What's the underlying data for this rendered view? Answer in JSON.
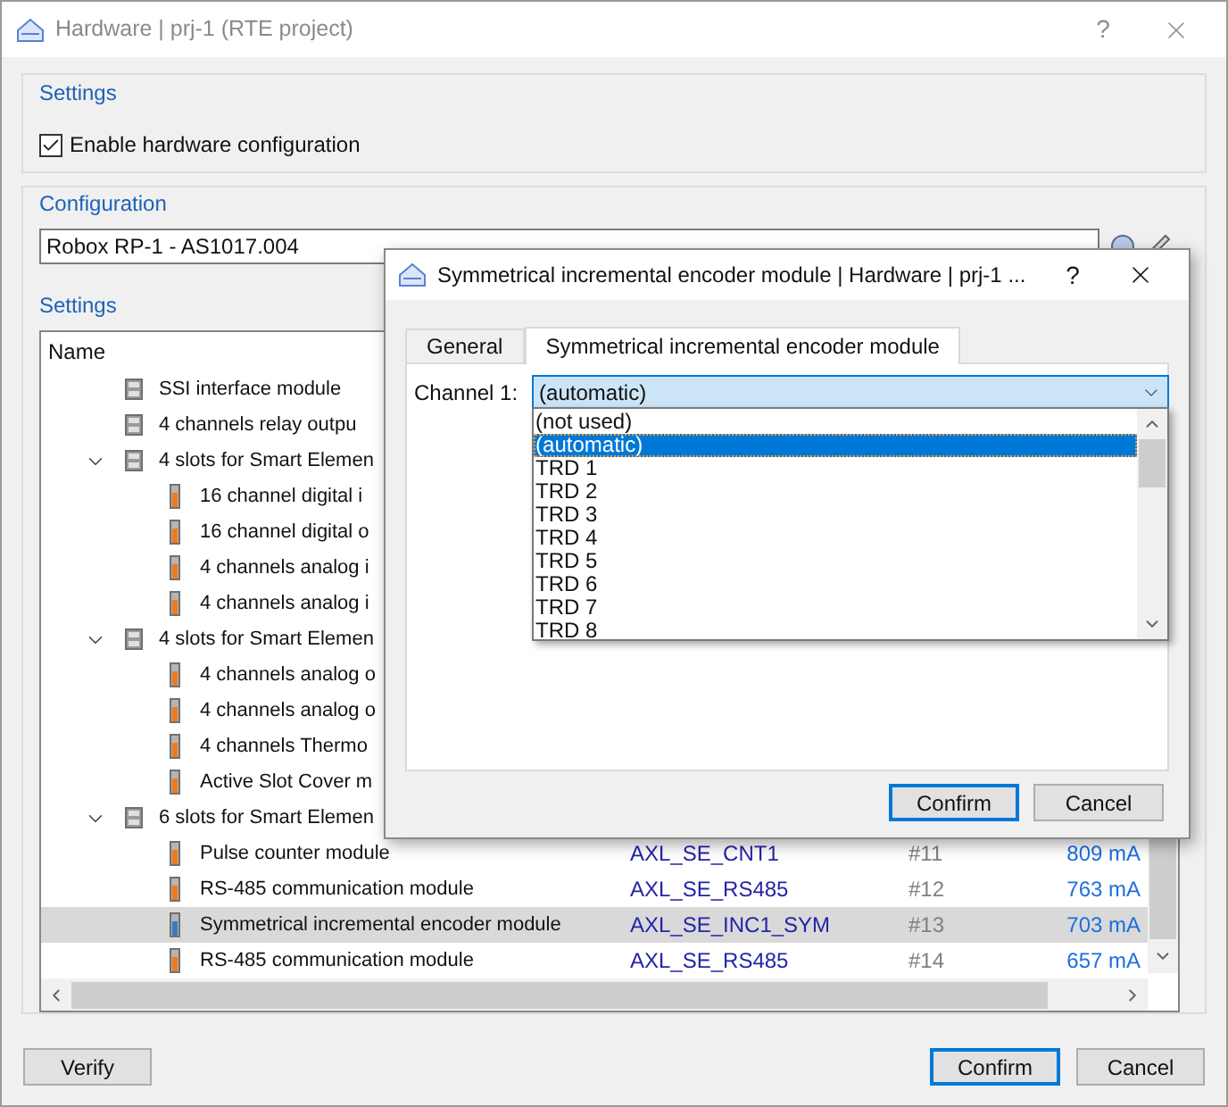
{
  "window": {
    "title": "Hardware | prj-1 (RTE project)",
    "help": "?"
  },
  "settings": {
    "title": "Settings",
    "enable_checkbox": {
      "label": "Enable hardware configuration",
      "checked": true
    }
  },
  "configuration": {
    "title": "Configuration",
    "device": "Robox RP-1 - AS1017.004",
    "settings_title": "Settings",
    "tree": {
      "columns": [
        "Name"
      ],
      "items": [
        {
          "name": "SSI interface module",
          "kind": "base",
          "selected": false
        },
        {
          "name": "4 channels relay outpu",
          "kind": "base",
          "selected": false
        },
        {
          "name": "4 slots for Smart Elemen",
          "kind": "base",
          "selected": false,
          "expanded": true,
          "children": [
            {
              "name": "16 channel digital i",
              "kind": "slot",
              "selected": false
            },
            {
              "name": "16 channel digital o",
              "kind": "slot",
              "selected": false
            },
            {
              "name": "4 channels analog i",
              "kind": "slot",
              "selected": false
            },
            {
              "name": "4 channels analog i",
              "kind": "slot",
              "selected": false
            }
          ]
        },
        {
          "name": "4 slots for Smart Elemen",
          "kind": "base",
          "selected": false,
          "expanded": true,
          "children": [
            {
              "name": "4 channels analog o",
              "kind": "slot",
              "selected": false
            },
            {
              "name": "4 channels analog o",
              "kind": "slot",
              "selected": false
            },
            {
              "name": "4 channels Thermo",
              "kind": "slot",
              "selected": false
            },
            {
              "name": "Active Slot Cover m",
              "kind": "slot",
              "selected": false
            }
          ]
        },
        {
          "name": "6 slots for Smart Elemen",
          "kind": "base",
          "selected": false,
          "expanded": true,
          "children": [
            {
              "name": "Pulse counter module",
              "kind": "slot",
              "selected": false,
              "code": "AXL_SE_CNT1",
              "slot": "#11",
              "current": "809 mA"
            },
            {
              "name": "RS-485 communication module",
              "kind": "slot",
              "selected": false,
              "code": "AXL_SE_RS485",
              "slot": "#12",
              "current": "763 mA"
            },
            {
              "name": "Symmetrical incremental encoder module",
              "kind": "slot",
              "selected": true,
              "code": "AXL_SE_INC1_SYM",
              "slot": "#13",
              "current": "703 mA"
            },
            {
              "name": "RS-485 communication module",
              "kind": "slot",
              "selected": false,
              "code": "AXL_SE_RS485",
              "slot": "#14",
              "current": "657 mA"
            }
          ]
        }
      ]
    }
  },
  "buttons": [
    "Verify",
    "Confirm",
    "Cancel"
  ],
  "dialog": {
    "title": "Symmetrical incremental encoder module | Hardware | prj-1 ...",
    "help": "?",
    "tabs": [
      {
        "label": "General",
        "selected": false
      },
      {
        "label": "Symmetrical incremental encoder module",
        "selected": true
      }
    ],
    "channel": {
      "label": "Channel 1:",
      "value": "(automatic)",
      "expanded": true,
      "options": [
        {
          "label": "(not used)",
          "selected": false
        },
        {
          "label": "(automatic)",
          "selected": true
        },
        {
          "label": "TRD 1",
          "selected": false
        },
        {
          "label": "TRD 2",
          "selected": false
        },
        {
          "label": "TRD 3",
          "selected": false
        },
        {
          "label": "TRD 4",
          "selected": false
        },
        {
          "label": "TRD 5",
          "selected": false
        },
        {
          "label": "TRD 6",
          "selected": false
        },
        {
          "label": "TRD 7",
          "selected": false
        },
        {
          "label": "TRD 8",
          "selected": false
        }
      ]
    },
    "buttons": [
      "Confirm",
      "Cancel"
    ]
  }
}
